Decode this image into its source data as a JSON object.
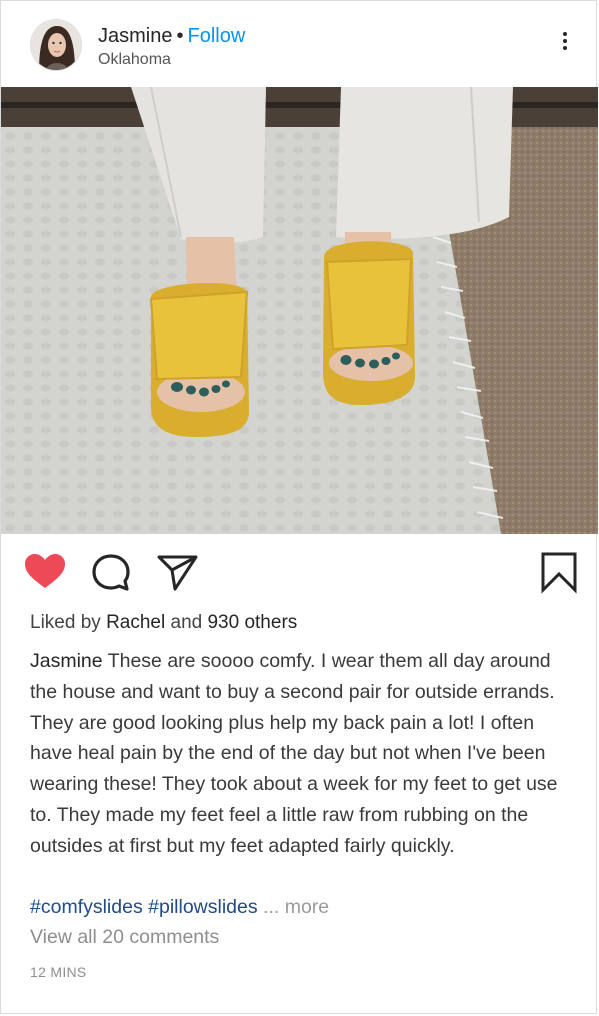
{
  "post": {
    "user": {
      "name": "Jasmine",
      "separator": "•",
      "follow_label": "Follow",
      "location": "Oklahoma"
    },
    "icons": {
      "more": "more-vertical-icon",
      "like": "heart-filled-icon",
      "comment": "comment-bubble-icon",
      "share": "paper-plane-icon",
      "save": "bookmark-icon"
    },
    "colors": {
      "like_red": "#ed4956",
      "link_blue": "#0095f6",
      "hashtag": "#1f4b8a",
      "slide_yellow": "#e8c23a"
    },
    "likes": {
      "prefix": "Liked by",
      "first_user": "Rachel",
      "middle": "and",
      "others": "930 others"
    },
    "caption": {
      "username": "Jasmine",
      "text": "These are soooo comfy. I wear them all day around the house and want to buy a second pair for outside errands. They are good looking plus help my back pain a lot! I often have heal pain by the end of the day but not when I've been wearing these! They took about a week for my feet to get use to. They made my feet feel a little raw from rubbing on the outsides at first but my feet adapted fairly quickly."
    },
    "hashtags": [
      "#comfyslides",
      "#pillowslides"
    ],
    "more_label": "... more",
    "view_comments": "View all 20 comments",
    "timestamp": "12 MINS"
  }
}
